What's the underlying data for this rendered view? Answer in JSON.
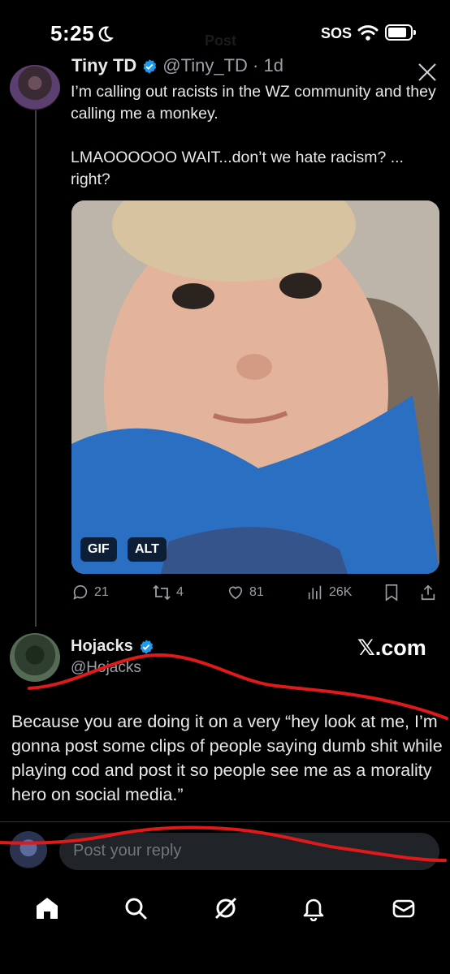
{
  "status_bar": {
    "time": "5:25",
    "sos": "SOS",
    "header_title": "Post"
  },
  "quoted_tweet": {
    "display_name": "Tiny TD",
    "handle": "@Tiny_TD",
    "time": "· 1d",
    "text": "I’m calling out racists in the WZ community and they calling me a monkey.\n\nLMAOOOOOO WAIT...don’t we hate racism? ... right?",
    "media_badges": {
      "gif": "GIF",
      "alt": "ALT"
    },
    "stats": {
      "replies": "21",
      "reposts": "4",
      "likes": "81",
      "views": "26K"
    }
  },
  "main_tweet": {
    "display_name": "Hojacks",
    "handle": "@Hojacks",
    "brand": "𝕏.com",
    "text": "Because you are doing it on a very “hey look at me, I’m gonna post some clips of people saying dumb shit while playing cod and post it so people see me as a morality hero on social media.”"
  },
  "reply": {
    "placeholder": "Post your reply"
  },
  "colors": {
    "verified": "#1d9bf0",
    "annotation": "#e0191a",
    "background": "#000000"
  },
  "icons": [
    "moon-icon",
    "wifi-icon",
    "battery-icon",
    "close-x-icon",
    "reply-icon",
    "repost-icon",
    "like-icon",
    "views-icon",
    "bookmark-icon",
    "share-icon",
    "home-icon",
    "search-icon",
    "grok-icon",
    "notifications-icon",
    "messages-icon"
  ]
}
